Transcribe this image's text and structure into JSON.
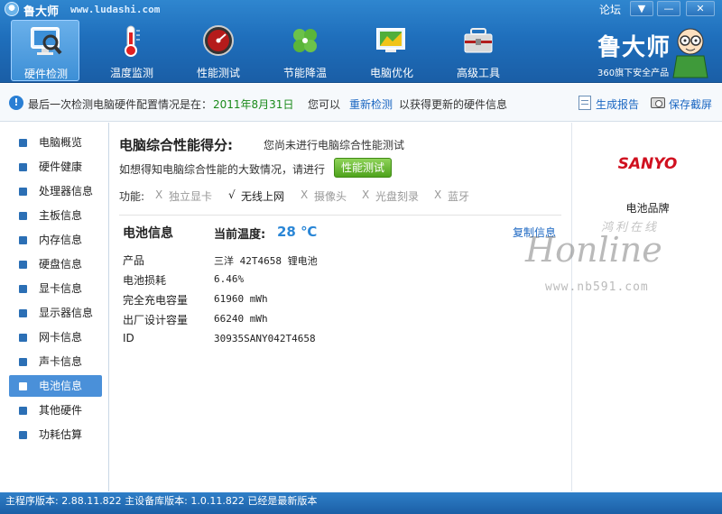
{
  "app": {
    "title": "鲁大师",
    "url": "www.ludashi.com",
    "forum": "论坛",
    "window_menu": "▼",
    "window_min": "—",
    "window_close": "✕"
  },
  "toolbar": {
    "items": [
      {
        "label": "硬件检测",
        "icon": "monitor-magnifier-icon",
        "active": true
      },
      {
        "label": "温度监测",
        "icon": "thermometer-icon",
        "active": false
      },
      {
        "label": "性能测试",
        "icon": "speedometer-icon",
        "active": false
      },
      {
        "label": "节能降温",
        "icon": "clover-icon",
        "active": false
      },
      {
        "label": "电脑优化",
        "icon": "window-optimize-icon",
        "active": false
      },
      {
        "label": "高级工具",
        "icon": "toolbox-icon",
        "active": false
      }
    ]
  },
  "brand": {
    "name": "鲁大师",
    "subtitle": "360旗下安全产品"
  },
  "notice": {
    "prefix": "最后一次检测电脑硬件配置情况是在：",
    "date": "2011年8月31日",
    "middle": "您可以",
    "redetect": "重新检测",
    "suffix": "以获得更新的硬件信息",
    "report": "生成报告",
    "screenshot": "保存截屏"
  },
  "sidebar": {
    "items": [
      {
        "label": "电脑概览",
        "active": false
      },
      {
        "label": "硬件健康",
        "active": false
      },
      {
        "label": "处理器信息",
        "active": false
      },
      {
        "label": "主板信息",
        "active": false
      },
      {
        "label": "内存信息",
        "active": false
      },
      {
        "label": "硬盘信息",
        "active": false
      },
      {
        "label": "显卡信息",
        "active": false
      },
      {
        "label": "显示器信息",
        "active": false
      },
      {
        "label": "网卡信息",
        "active": false
      },
      {
        "label": "声卡信息",
        "active": false
      },
      {
        "label": "电池信息",
        "active": true
      },
      {
        "label": "其他硬件",
        "active": false
      },
      {
        "label": "功耗估算",
        "active": false
      }
    ]
  },
  "main": {
    "score_title": "电脑综合性能得分:",
    "score_note": "您尚未进行电脑综合性能测试",
    "score_desc": "如想得知电脑综合性能的大致情况，请进行",
    "perf_button": "性能测试",
    "features_label": "功能:",
    "features": [
      {
        "mark": "X",
        "label": "独立显卡",
        "available": false
      },
      {
        "mark": "√",
        "label": "无线上网",
        "available": true
      },
      {
        "mark": "X",
        "label": "摄像头",
        "available": false
      },
      {
        "mark": "X",
        "label": "光盘刻录",
        "available": false
      },
      {
        "mark": "X",
        "label": "蓝牙",
        "available": false
      }
    ],
    "battery_title": "电池信息",
    "temp_label": "当前温度:",
    "temp_value": "28 ℃",
    "copy_link": "复制信息",
    "rows": [
      {
        "label": "产品",
        "value": "三洋 42T4658 锂电池"
      },
      {
        "label": "电池损耗",
        "value": "6.46%"
      },
      {
        "label": "完全充电容量",
        "value": "61960 mWh"
      },
      {
        "label": "出厂设计容量",
        "value": "66240 mWh"
      },
      {
        "label": "ID",
        "value": "30935SANY042T4658"
      }
    ]
  },
  "right_panel": {
    "logo_text": "SANYO",
    "brand_label": "电池品牌"
  },
  "watermark": {
    "cn": "鸿利在线",
    "en": "Honline",
    "url": "www.nb591.com"
  },
  "status": {
    "text": "主程序版本: 2.88.11.822  主设备库版本: 1.0.11.822  已经是最新版本"
  },
  "colors": {
    "toolbar_blue": "#1f6fbc",
    "link_blue": "#1a66c2",
    "date_green": "#1a8a1a",
    "button_green": "#4ea31c",
    "sanyo_red": "#d0101f",
    "temp_blue": "#2a86d6"
  }
}
